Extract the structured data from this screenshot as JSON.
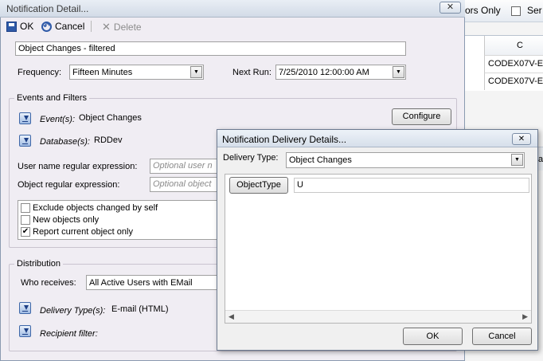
{
  "background": {
    "toolbar_text_1": "ors Only",
    "toolbar_text_2": "Ser",
    "grid_header": "C",
    "rows": [
      "CODEX07V-E",
      "CODEX07V-E"
    ],
    "strip_text": "ate"
  },
  "dialog": {
    "title": "Notification Detail...",
    "toolbar": {
      "ok": "OK",
      "cancel": "Cancel",
      "delete": "Delete"
    },
    "name_value": "Object Changes - filtered",
    "frequency": {
      "label": "Frequency:",
      "value": "Fifteen Minutes"
    },
    "next_run": {
      "label": "Next Run:",
      "value": "7/25/2010 12:00:00 AM"
    },
    "events_group": {
      "title": "Events and Filters",
      "events_label": "Event(s):",
      "events_value": "Object Changes",
      "databases_label": "Database(s):",
      "databases_value": "RDDev",
      "configure_button": "Configure",
      "username_label": "User name regular expression:",
      "username_placeholder": "Optional user n",
      "object_label": "Object regular expression:",
      "object_placeholder": "Optional object",
      "checks": [
        {
          "label": "Exclude objects changed by self",
          "checked": false
        },
        {
          "label": "New objects only",
          "checked": false
        },
        {
          "label": "Report current object only",
          "checked": true
        }
      ]
    },
    "distribution_group": {
      "title": "Distribution",
      "who_label": "Who receives:",
      "who_value": "All Active Users with EMail",
      "delivery_label": "Delivery Type(s):",
      "delivery_value": "E-mail (HTML)",
      "recipient_label": "Recipient filter:"
    }
  },
  "popup": {
    "title": "Notification Delivery Details...",
    "delivery_type_label": "Delivery Type:",
    "delivery_type_value": "Object Changes",
    "object_type_label": "ObjectType",
    "object_type_value": "U",
    "ok": "OK",
    "cancel": "Cancel"
  },
  "colors": {
    "accent": "#1c3f86",
    "dialog_bg": "#f0edf3"
  }
}
